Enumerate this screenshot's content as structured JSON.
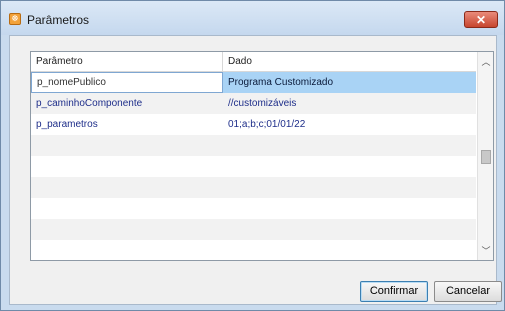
{
  "window": {
    "title": "Parâmetros",
    "close_label": "✕"
  },
  "grid": {
    "columns": [
      "Parâmetro",
      "Dado"
    ],
    "rows": [
      {
        "param": "p_nomePublico",
        "value": "Programa Customizado",
        "selected": true
      },
      {
        "param": "p_caminhoComponente",
        "value": "//customizáveis"
      },
      {
        "param": "p_parametros",
        "value": "01;a;b;c;01/01/22"
      },
      {
        "param": "",
        "value": ""
      },
      {
        "param": "",
        "value": ""
      },
      {
        "param": "",
        "value": ""
      },
      {
        "param": "",
        "value": ""
      },
      {
        "param": "",
        "value": ""
      },
      {
        "param": "",
        "value": ""
      }
    ]
  },
  "buttons": {
    "confirm": "Confirmar",
    "cancel": "Cancelar"
  },
  "icons": {
    "title_icon": "app-logo-icon",
    "scroll_up": "chevron-up-icon",
    "scroll_down": "chevron-down-icon"
  },
  "colors": {
    "selection": "#a9d3f5",
    "cell_text": "#1e2e8a"
  }
}
